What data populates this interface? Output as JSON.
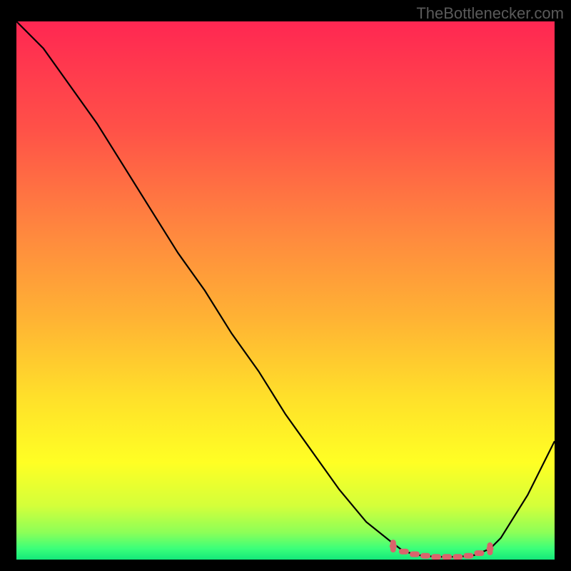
{
  "watermark": "TheBottlenecker.com",
  "chart_data": {
    "type": "line",
    "title": "",
    "xlabel": "",
    "ylabel": "",
    "xlim": [
      0,
      100
    ],
    "ylim": [
      0,
      100
    ],
    "series": [
      {
        "name": "curve",
        "color": "#000000",
        "x": [
          0,
          5,
          10,
          15,
          20,
          25,
          30,
          35,
          40,
          45,
          50,
          55,
          60,
          65,
          70,
          72,
          75,
          78,
          82,
          85,
          88,
          90,
          95,
          100
        ],
        "y": [
          100,
          95,
          88,
          81,
          73,
          65,
          57,
          50,
          42,
          35,
          27,
          20,
          13,
          7,
          3,
          1.5,
          0.8,
          0.5,
          0.5,
          0.8,
          2,
          4,
          12,
          22
        ]
      },
      {
        "name": "highlight",
        "color": "#d9646c",
        "style": "dotted",
        "x": [
          70,
          72,
          74,
          76,
          78,
          80,
          82,
          84,
          86,
          88
        ],
        "y": [
          2.5,
          1.5,
          1.0,
          0.7,
          0.5,
          0.5,
          0.5,
          0.7,
          1.2,
          2.0
        ]
      }
    ],
    "gradient_stops": [
      {
        "offset": 0.0,
        "color": "#ff2752"
      },
      {
        "offset": 0.2,
        "color": "#ff5148"
      },
      {
        "offset": 0.4,
        "color": "#ff8a3e"
      },
      {
        "offset": 0.55,
        "color": "#ffb234"
      },
      {
        "offset": 0.7,
        "color": "#ffe02a"
      },
      {
        "offset": 0.82,
        "color": "#ffff24"
      },
      {
        "offset": 0.9,
        "color": "#d4ff3a"
      },
      {
        "offset": 0.95,
        "color": "#8cff58"
      },
      {
        "offset": 0.98,
        "color": "#3aff7a"
      },
      {
        "offset": 1.0,
        "color": "#14e87a"
      }
    ]
  }
}
